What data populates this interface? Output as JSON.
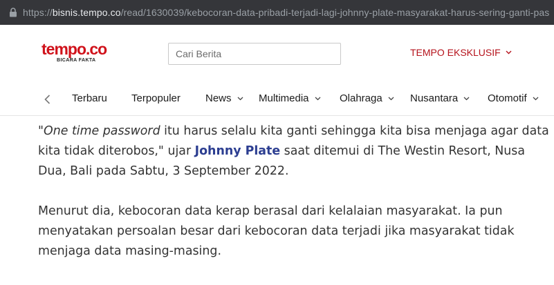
{
  "browser": {
    "url_scheme": "https://",
    "url_host": "bisnis.tempo.co",
    "url_path": "/read/1630039/kebocoran-data-pribadi-terjadi-lagi-johnny-plate-masyarakat-harus-sering-ganti-pas"
  },
  "header": {
    "logo_text": "tempo.co",
    "logo_tagline": "BICARA FAKTA",
    "search_placeholder": "Cari Berita",
    "exclusive_label": "TEMPO EKSKLUSIF"
  },
  "nav": {
    "items": [
      {
        "label": "Terbaru",
        "has_dropdown": false
      },
      {
        "label": "Terpopuler",
        "has_dropdown": false
      },
      {
        "label": "News",
        "has_dropdown": true
      },
      {
        "label": "Multimedia",
        "has_dropdown": true
      },
      {
        "label": "Olahraga",
        "has_dropdown": true
      },
      {
        "label": "Nusantara",
        "has_dropdown": true
      },
      {
        "label": "Otomotif",
        "has_dropdown": true
      }
    ]
  },
  "article": {
    "p1": {
      "open_quote": "\"",
      "italic": "One time password",
      "text1": " itu harus selalu kita ganti sehingga kita bisa menjaga agar data kita tidak diterobos,\" ujar ",
      "link": "Johnny Plate",
      "text2": " saat ditemui di The Westin Resort, Nusa Dua, Bali pada Sabtu, 3 September 2022."
    },
    "p2": "Menurut dia, kebocoran data kerap berasal dari kelalaian masyarakat. Ia pun menyatakan persoalan besar dari kebocoran data terjadi jika masyarakat tidak menjaga data masing-masing."
  },
  "colors": {
    "brand_red": "#d0121b",
    "link_blue": "#2c3e91",
    "urlbar_bg": "#35363a"
  }
}
